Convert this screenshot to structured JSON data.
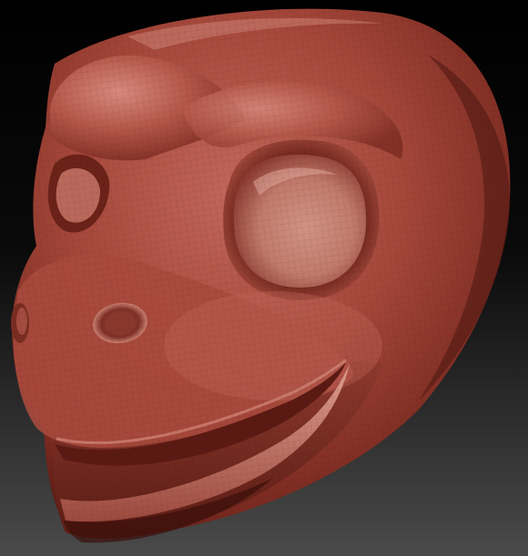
{
  "scene": {
    "subject": "sculpt-render",
    "colors": {
      "background_top": "#000000",
      "background_bottom": "#4a4a4a",
      "clay_base": "#a8473a",
      "clay_highlight": "#d98a7e",
      "clay_shadow": "#4a1510",
      "clay_deep_shadow": "#2a0806"
    }
  }
}
